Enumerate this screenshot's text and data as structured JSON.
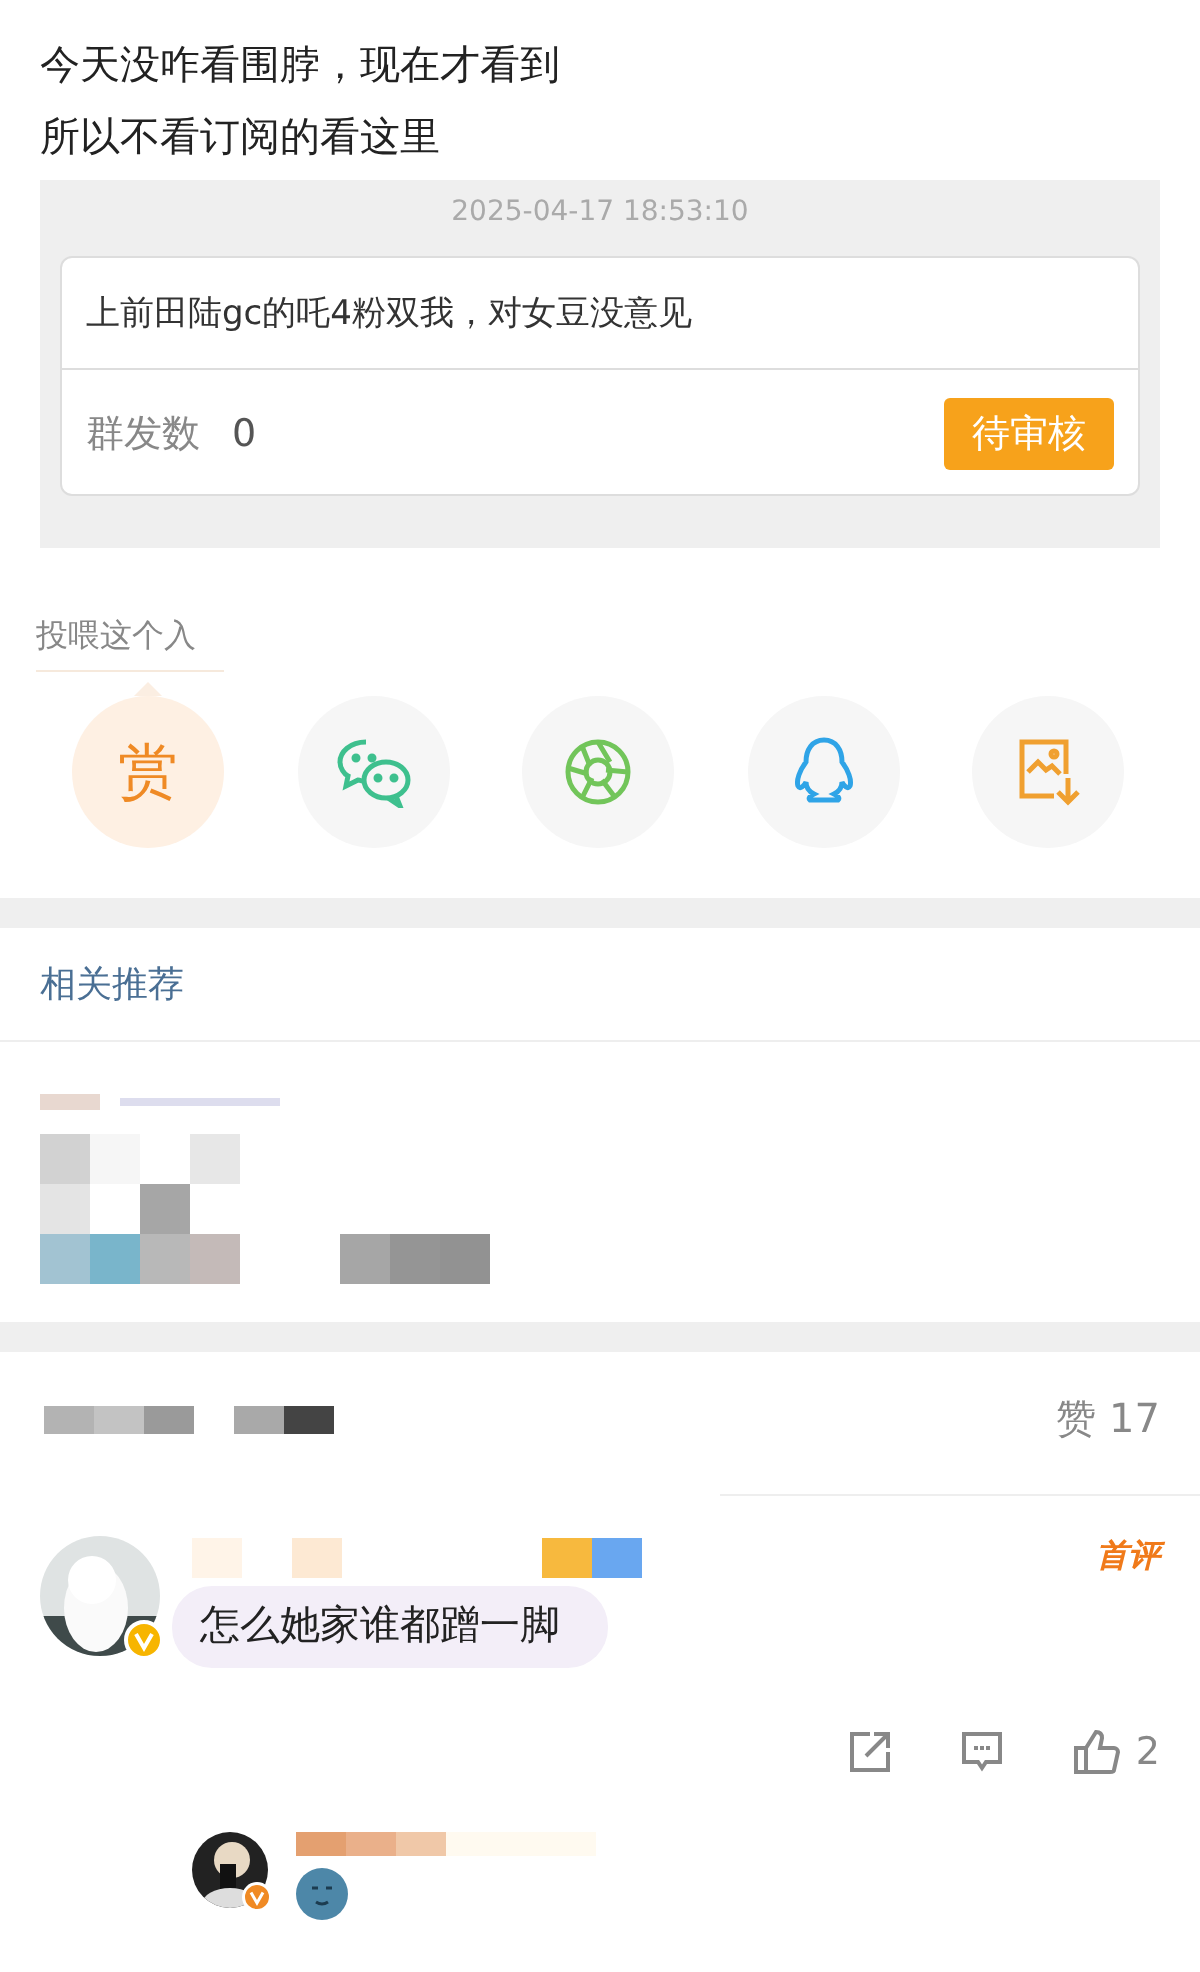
{
  "post": {
    "lines": [
      "今天没咋看围脖，现在才看到",
      "所以不看订阅的看这里"
    ]
  },
  "message_card": {
    "timestamp": "2025-04-17 18:53:10",
    "message": "上前田陆gc的吒4粉双我，对女豆没意见",
    "count_label": "群发数",
    "count": "0",
    "status_button": "待审核"
  },
  "reward": {
    "label": "投喂这个入",
    "options": [
      {
        "kind": "reward",
        "label": "赏",
        "selected": true
      },
      {
        "kind": "wechat",
        "selected": false
      },
      {
        "kind": "moments",
        "selected": false
      },
      {
        "kind": "qq",
        "selected": false
      },
      {
        "kind": "save_image",
        "selected": false
      }
    ]
  },
  "related": {
    "title": "相关推荐"
  },
  "stats": {
    "likes": "赞 17"
  },
  "comments": [
    {
      "badge": "首评",
      "text": "怎么她家谁都蹭一脚",
      "likes": "2",
      "replies": [
        {
          "kind": "emoji"
        }
      ]
    }
  ]
}
